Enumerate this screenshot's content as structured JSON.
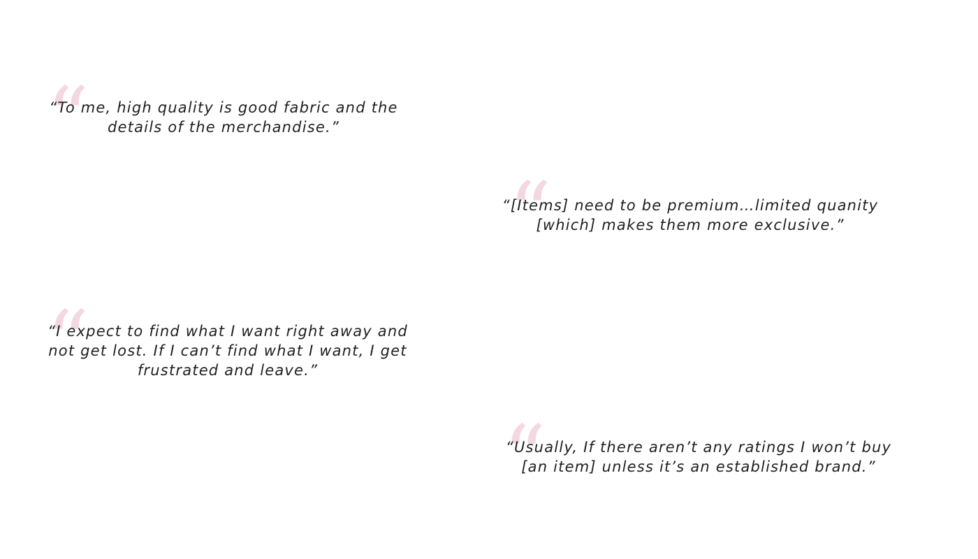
{
  "icons": {
    "quote_mark_glyph": "“",
    "quote_mark_color": "#f3d9df",
    "quote_mark_icon": "open-quote-icon"
  },
  "quotes": [
    {
      "text": "“To me, high quality is good fabric and the details of the merchandise.”"
    },
    {
      "text": "“[Items] need to be premium…limited quanity [which] makes them more exclusive.”"
    },
    {
      "text": "“I expect to find what I want right away and not get lost. If I can’t find what I want, I get frustrated and leave.”"
    },
    {
      "text": "“Usually, If there aren’t any ratings I won’t buy [an item] unless it’s an established brand.”"
    }
  ]
}
